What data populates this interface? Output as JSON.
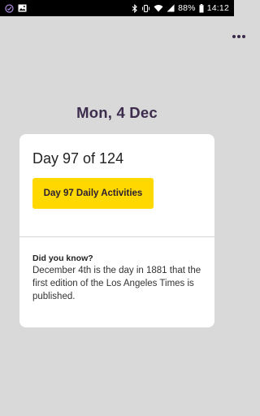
{
  "status_bar": {
    "battery_percent": "88%",
    "time": "14:12",
    "left_icons": [
      "app-notification-icon",
      "image-icon"
    ],
    "right_icons": [
      "bluetooth-icon",
      "vibrate-icon",
      "wifi-icon",
      "signal-icon",
      "battery-icon"
    ]
  },
  "header": {
    "menu_icon": "more-dots-icon"
  },
  "date_label": "Mon, 4 Dec",
  "card": {
    "day_counter": "Day 97 of 124",
    "activities_button": "Day 97 Daily Activities",
    "fact_heading": "Did you know?",
    "fact_body": "December 4th is the day in 1881 that the first edition of the Los Angeles Times is published."
  },
  "colors": {
    "background": "#d9d9d9",
    "card": "#ffffff",
    "accent_button": "#ffd800",
    "title_text": "#3d2c4d"
  }
}
